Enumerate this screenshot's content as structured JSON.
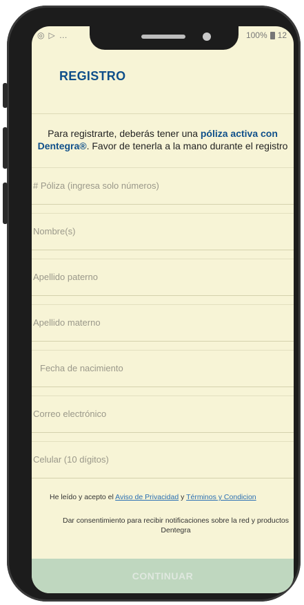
{
  "status_bar": {
    "left_icons": [
      "notification-icon",
      "play-icon"
    ],
    "battery_text": "100%",
    "clock_partial": "12"
  },
  "header": {
    "title": "REGISTRO"
  },
  "intro": {
    "part1": "Para registrarte, deberás tener una ",
    "strong": "póliza activa con Dentegra®",
    "part2": ". Favor de tenerla a la mano durante el registro"
  },
  "form": {
    "poliza_placeholder": "# Póliza (ingresa solo números)",
    "nombre_placeholder": "Nombre(s)",
    "apellido_paterno_placeholder": "Apellido paterno",
    "apellido_materno_placeholder": "Apellido materno",
    "fecha_placeholder": "Fecha de nacimiento",
    "correo_placeholder": "Correo electrónico",
    "celular_placeholder": "Celular (10 dígitos)"
  },
  "consent": {
    "prefix": "He leído y acepto el ",
    "privacy_link": "Aviso de Privacidad",
    "and": " y ",
    "terms_link": "Términos y Condicion",
    "notifications_text": "Dar consentimiento para recibir notificaciones sobre la red y productos Dentegra"
  },
  "actions": {
    "continue_label": "CONTINUAR"
  },
  "colors": {
    "screen_bg": "#f7f4d6",
    "title_blue": "#0f4f8a",
    "link_blue": "#2a6fb3",
    "continue_disabled": "#bfd7bf"
  }
}
